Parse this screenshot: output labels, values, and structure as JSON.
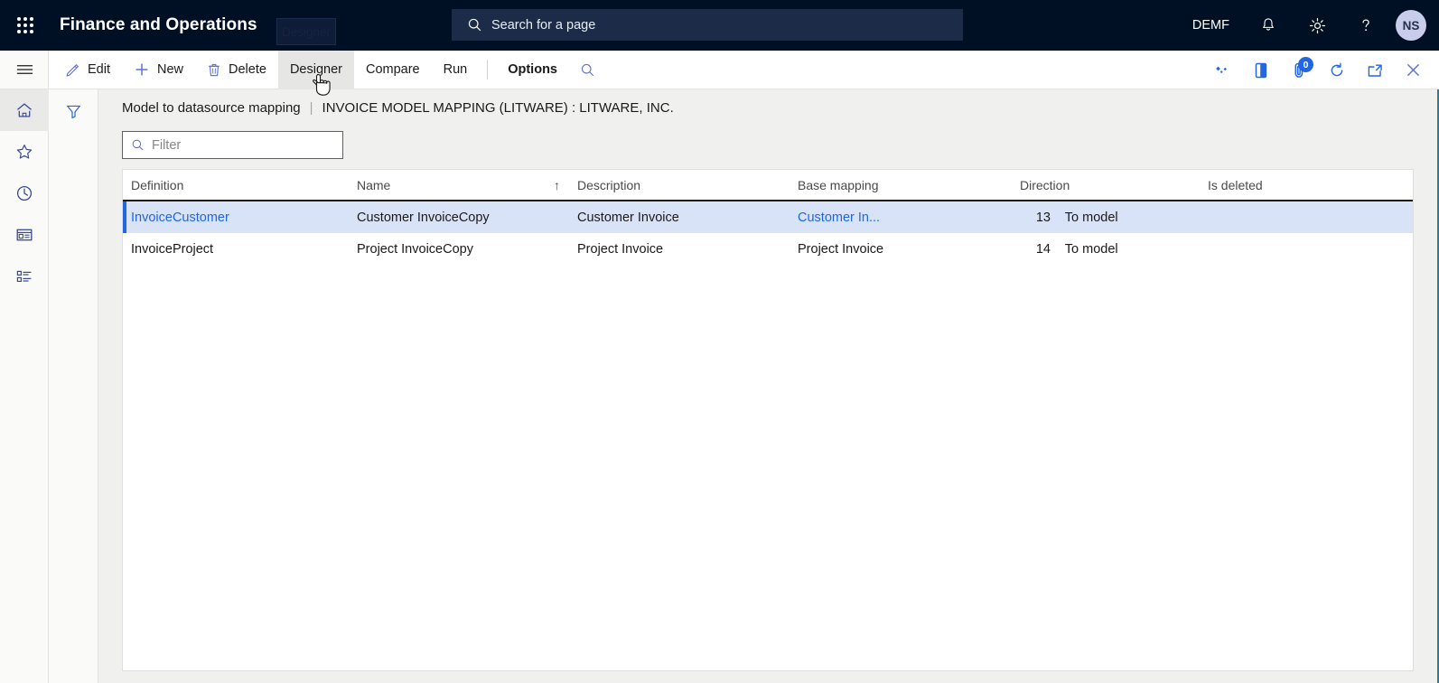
{
  "topbar": {
    "waffle_icon": "app-launcher-icon",
    "app_title": "Finance and Operations",
    "tooltip": "Designer",
    "search": {
      "placeholder": "Search for a page",
      "icon": "search-icon"
    },
    "company": "DEMF",
    "notifications_icon": "bell-icon",
    "settings_icon": "gear-icon",
    "help_icon": "help-question-icon",
    "avatar_initials": "NS"
  },
  "actionpane": {
    "buttons": [
      {
        "label": "Edit",
        "icon": "pencil-icon",
        "hover": false,
        "bold": false
      },
      {
        "label": "New",
        "icon": "plus-icon",
        "hover": false,
        "bold": false
      },
      {
        "label": "Delete",
        "icon": "trash-icon",
        "hover": false,
        "bold": false
      },
      {
        "label": "Designer",
        "icon": "",
        "hover": true,
        "bold": false
      },
      {
        "label": "Compare",
        "icon": "",
        "hover": false,
        "bold": false
      },
      {
        "label": "Run",
        "icon": "",
        "hover": false,
        "bold": false
      },
      {
        "label": "Options",
        "icon": "",
        "hover": false,
        "bold": true
      }
    ],
    "search_icon": "search-icon",
    "right_icons": [
      "personalize-diamond-icon",
      "office-app-icon",
      "attachments-icon",
      "refresh-icon",
      "open-in-new-window-icon",
      "close-icon"
    ],
    "attachments_badge": "0"
  },
  "navrail": {
    "items": [
      {
        "icon": "hamburger-menu-icon",
        "name": "expand-nav"
      },
      {
        "icon": "home-icon",
        "name": "home",
        "active": true
      },
      {
        "icon": "star-icon",
        "name": "favorites"
      },
      {
        "icon": "clock-icon",
        "name": "recent"
      },
      {
        "icon": "workspaces-icon",
        "name": "workspaces"
      },
      {
        "icon": "modules-list-icon",
        "name": "modules"
      }
    ]
  },
  "filterpane": {
    "icon": "filter-funnel-icon"
  },
  "caption": {
    "breadcrumb": "Model to datasource mapping",
    "separator": "|",
    "title": "INVOICE MODEL MAPPING (LITWARE) : LITWARE, INC."
  },
  "filter": {
    "placeholder": "Filter",
    "value": "",
    "icon": "search-icon"
  },
  "grid": {
    "columns": [
      {
        "label": "Definition",
        "sorted": false
      },
      {
        "label": "Name",
        "sorted": true,
        "sort_arrow": "↑"
      },
      {
        "label": "Description",
        "sorted": false
      },
      {
        "label": "Base mapping",
        "sorted": false
      },
      {
        "label": "Direction",
        "sorted": false
      },
      {
        "label": "Is deleted",
        "sorted": false
      }
    ],
    "rows": [
      {
        "selected": true,
        "definition": "InvoiceCustomer",
        "name": "Customer InvoiceCopy",
        "description": "Customer Invoice",
        "base_mapping": "Customer In...",
        "base_mapping_is_link": true,
        "number": "13",
        "direction": "To model",
        "is_deleted": ""
      },
      {
        "selected": false,
        "definition": "InvoiceProject",
        "name": "Project InvoiceCopy",
        "description": "Project Invoice",
        "base_mapping": "Project Invoice",
        "base_mapping_is_link": false,
        "number": "14",
        "direction": "To model",
        "is_deleted": ""
      }
    ]
  },
  "colors": {
    "nav_bg": "#001024",
    "accent_blue": "#2266e3",
    "selected_row": "#d9e3f7",
    "page_bg": "#f0f0ef"
  }
}
